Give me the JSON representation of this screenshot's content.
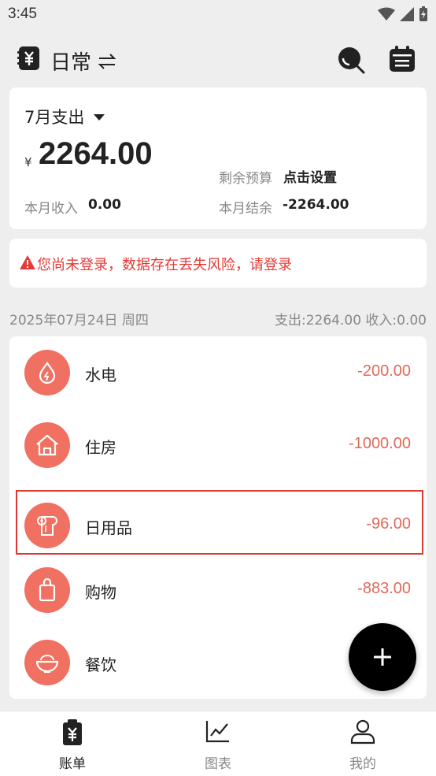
{
  "status": {
    "time": "3:45"
  },
  "header": {
    "title": "日常"
  },
  "summary": {
    "month": "7月支出",
    "currency": "¥",
    "expense": "2264.00",
    "budget_label": "剩余预算",
    "budget_value": "点击设置",
    "income_label": "本月收入",
    "income_value": "0.00",
    "balance_label": "本月结余",
    "balance_value": "-2264.00"
  },
  "warning": {
    "text": "您尚未登录，数据存在丢失风险，请登录"
  },
  "day": {
    "date": "2025年07月24日 周四",
    "totals": "支出:2264.00  收入:0.00"
  },
  "records": [
    {
      "category": "水电",
      "amount": "-200.00",
      "icon": "water-drop-icon"
    },
    {
      "category": "住房",
      "amount": "-1000.00",
      "icon": "house-icon"
    },
    {
      "category": "日用品",
      "amount": "-96.00",
      "icon": "toilet-paper-icon"
    },
    {
      "category": "购物",
      "amount": "-883.00",
      "icon": "shopping-bag-icon"
    },
    {
      "category": "餐饮",
      "amount": "",
      "icon": "food-bowl-icon"
    }
  ],
  "nav": {
    "items": [
      {
        "label": "账单",
        "icon": "bill-icon",
        "active": true
      },
      {
        "label": "图表",
        "icon": "chart-icon",
        "active": false
      },
      {
        "label": "我的",
        "icon": "user-icon",
        "active": false
      }
    ]
  },
  "colors": {
    "accent": "#f07061",
    "expense_text": "#e0695b",
    "warning": "#e53935"
  }
}
